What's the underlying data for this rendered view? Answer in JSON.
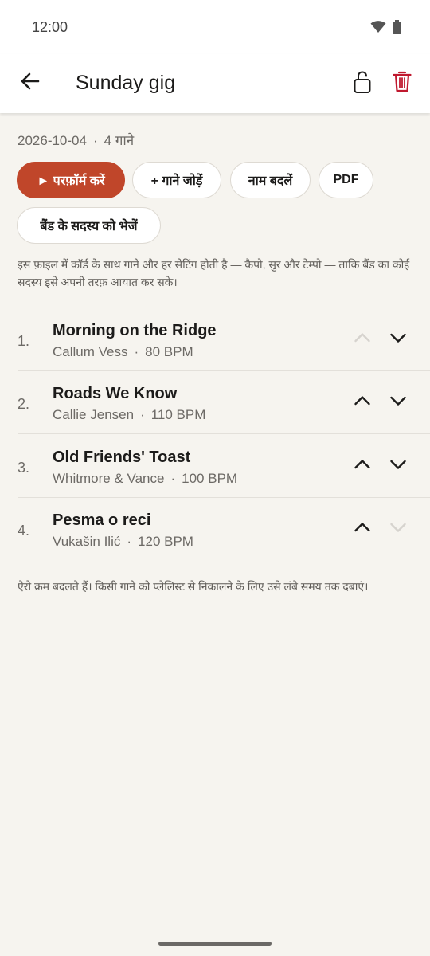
{
  "status_bar": {
    "time": "12:00"
  },
  "app_bar": {
    "title": "Sunday gig"
  },
  "setlist": {
    "date": "2026-10-04",
    "dot": "·",
    "song_count": "4 गाने"
  },
  "actions": {
    "perform": "► परफ़ॉर्म करें",
    "add_songs": "+ गाने जोड़ें",
    "rename": "नाम बदलें",
    "pdf": "PDF",
    "send_to_band": "बैंड के सदस्य को भेजें"
  },
  "info_text": "इस फ़ाइल में कॉर्ड के साथ गाने और हर सेटिंग होती है — कैपो, सुर और टेम्पो — ताकि बैंड का कोई सदस्य इसे अपनी तरफ़ आयात कर सके।",
  "songs": [
    {
      "num": "1.",
      "title": "Morning on the Ridge",
      "artist": "Callum Vess",
      "dot": "·",
      "bpm": "80 BPM",
      "up_enabled": false,
      "down_enabled": true
    },
    {
      "num": "2.",
      "title": "Roads We Know",
      "artist": "Callie Jensen",
      "dot": "·",
      "bpm": "110 BPM",
      "up_enabled": true,
      "down_enabled": true
    },
    {
      "num": "3.",
      "title": "Old Friends' Toast",
      "artist": "Whitmore & Vance",
      "dot": "·",
      "bpm": "100 BPM",
      "up_enabled": true,
      "down_enabled": true
    },
    {
      "num": "4.",
      "title": "Pesma o reci",
      "artist": "Vukašin Ilić",
      "dot": "·",
      "bpm": "120 BPM",
      "up_enabled": true,
      "down_enabled": false
    }
  ],
  "hint_text": "ऐरो क्रम बदलते हैं। किसी गाने को प्लेलिस्ट से निकालने के लिए उसे लंबे समय तक दबाएं।",
  "colors": {
    "accent": "#c0462a",
    "delete": "#c0192f",
    "background": "#f6f4ef",
    "disabled_arrow": "#d6d3ce",
    "enabled_arrow": "#1c1b1a"
  }
}
